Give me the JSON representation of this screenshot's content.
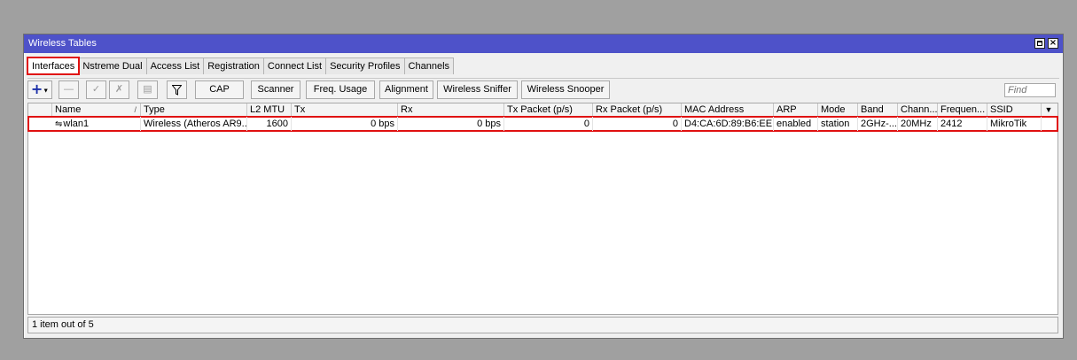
{
  "window": {
    "title": "Wireless Tables"
  },
  "tabs": [
    {
      "label": "Interfaces",
      "active": true
    },
    {
      "label": "Nstreme Dual"
    },
    {
      "label": "Access List"
    },
    {
      "label": "Registration"
    },
    {
      "label": "Connect List"
    },
    {
      "label": "Security Profiles"
    },
    {
      "label": "Channels"
    }
  ],
  "toolbar": {
    "icons": [
      "add-icon",
      "remove-icon",
      "enable-icon",
      "disable-icon",
      "comment-icon",
      "filter-icon"
    ],
    "buttons": [
      "CAP",
      "Scanner",
      "Freq. Usage",
      "Alignment",
      "Wireless Sniffer",
      "Wireless Snooper"
    ],
    "find_placeholder": "Find"
  },
  "table": {
    "columns": [
      "Name",
      "Type",
      "L2 MTU",
      "Tx",
      "Rx",
      "Tx Packet (p/s)",
      "Rx Packet (p/s)",
      "MAC Address",
      "ARP",
      "Mode",
      "Band",
      "Chann...",
      "Frequen...",
      "SSID"
    ],
    "rows": [
      {
        "name": "wlan1",
        "type": "Wireless (Atheros AR9...",
        "l2mtu": "1600",
        "tx": "0 bps",
        "rx": "0 bps",
        "tx_packet": "0",
        "rx_packet": "0",
        "mac": "D4:CA:6D:89:B6:EE",
        "arp": "enabled",
        "mode": "station",
        "band": "2GHz-...",
        "channel": "20MHz",
        "frequency": "2412",
        "ssid": "MikroTik"
      }
    ]
  },
  "status": {
    "text": "1 item out of 5"
  },
  "colors": {
    "titlebar": "#4e52c9",
    "highlight": "#e01010",
    "add_icon": "#1a2ea8"
  }
}
